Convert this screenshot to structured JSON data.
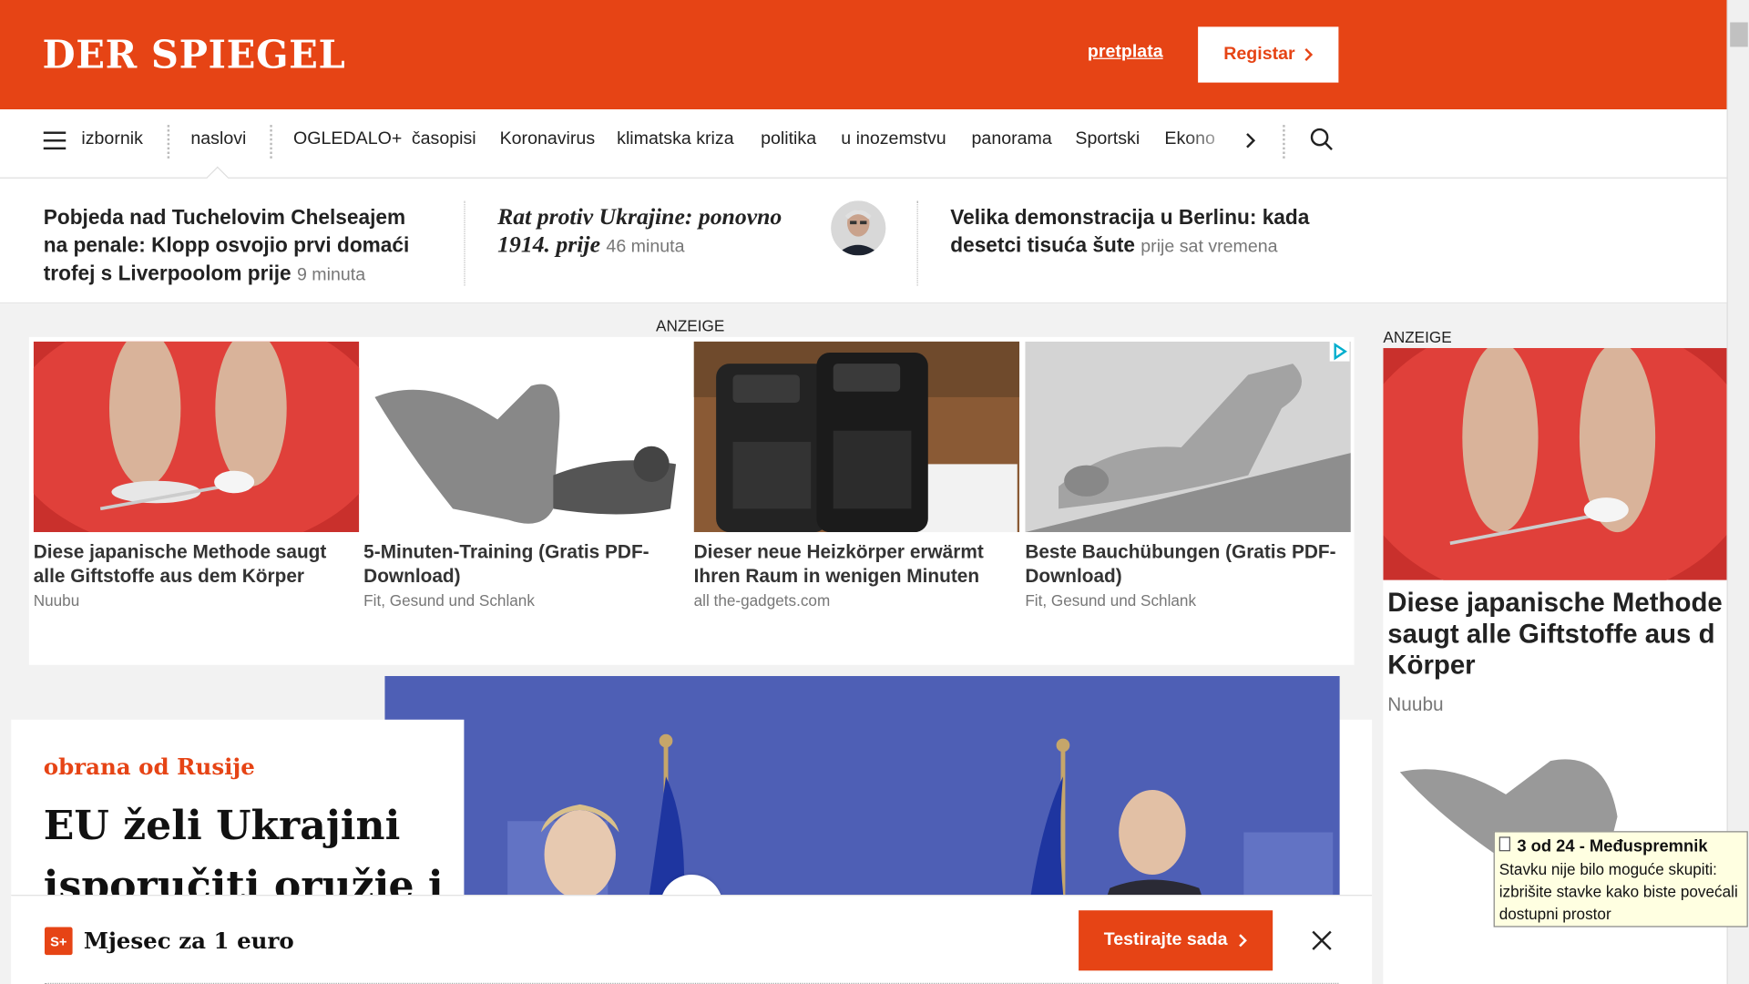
{
  "header": {
    "logo": "DER SPIEGEL",
    "subscribe_link": "pretplata",
    "register_button": "Registar",
    "brand_color": "#e64415"
  },
  "nav": {
    "menu_label": "izbornik",
    "items": [
      "naslovi",
      "OGLEDALO+",
      "časopisi",
      "Koronavirus",
      "klimatska kriza",
      "politika",
      "u inozemstvu",
      "panorama",
      "Sportski",
      "Ekono"
    ],
    "more_icon": "chevron-right-icon",
    "search_icon": "search-icon"
  },
  "teasers": [
    {
      "title": "Pobjeda nad Tuchelovim Chelseajem na penale: Klopp osvojio prvi domaći trofej s Liverpoolom prije",
      "time": "9 minuta"
    },
    {
      "title": "Rat protiv Ukrajine: ponovno 1914. prije",
      "time": "46 minuta"
    },
    {
      "title": "Velika demonstracija u Berlinu: kada desetci tisuća šute",
      "time": "prije sat vremena"
    }
  ],
  "ad": {
    "label": "ANZEIGE",
    "cards": [
      {
        "title": "Diese japanische Methode saugt alle Giftstoffe aus dem Körper",
        "source": "Nuubu"
      },
      {
        "title": "5-Minuten-Training (Gratis PDF-Download)",
        "source": "Fit, Gesund und Schlank"
      },
      {
        "title": "Dieser neue Heizkörper erwärmt Ihren Raum in wenigen Minuten",
        "source": "all the-gadgets.com"
      },
      {
        "title": "Beste Bauchübungen (Gratis PDF-Download)",
        "source": "Fit, Gesund und Schlank"
      }
    ]
  },
  "right_ad": {
    "label": "ANZEIGE",
    "title": "Diese japanische Methode saugt alle Giftstoffe aus d Körper",
    "source": "Nuubu"
  },
  "article": {
    "kicker": "obrana od Rusije",
    "headline": "EU želi Ukrajini isporučiti oružje i"
  },
  "banner": {
    "badge": "S+",
    "text": "Mjesec za 1 euro",
    "button": "Testirajte sada"
  },
  "tooltip": {
    "title": "3 od 24 - Međuspremnik",
    "body": "Stavku nije bilo moguće skupiti: izbrišite stavke kako biste povećali dostupni prostor"
  }
}
